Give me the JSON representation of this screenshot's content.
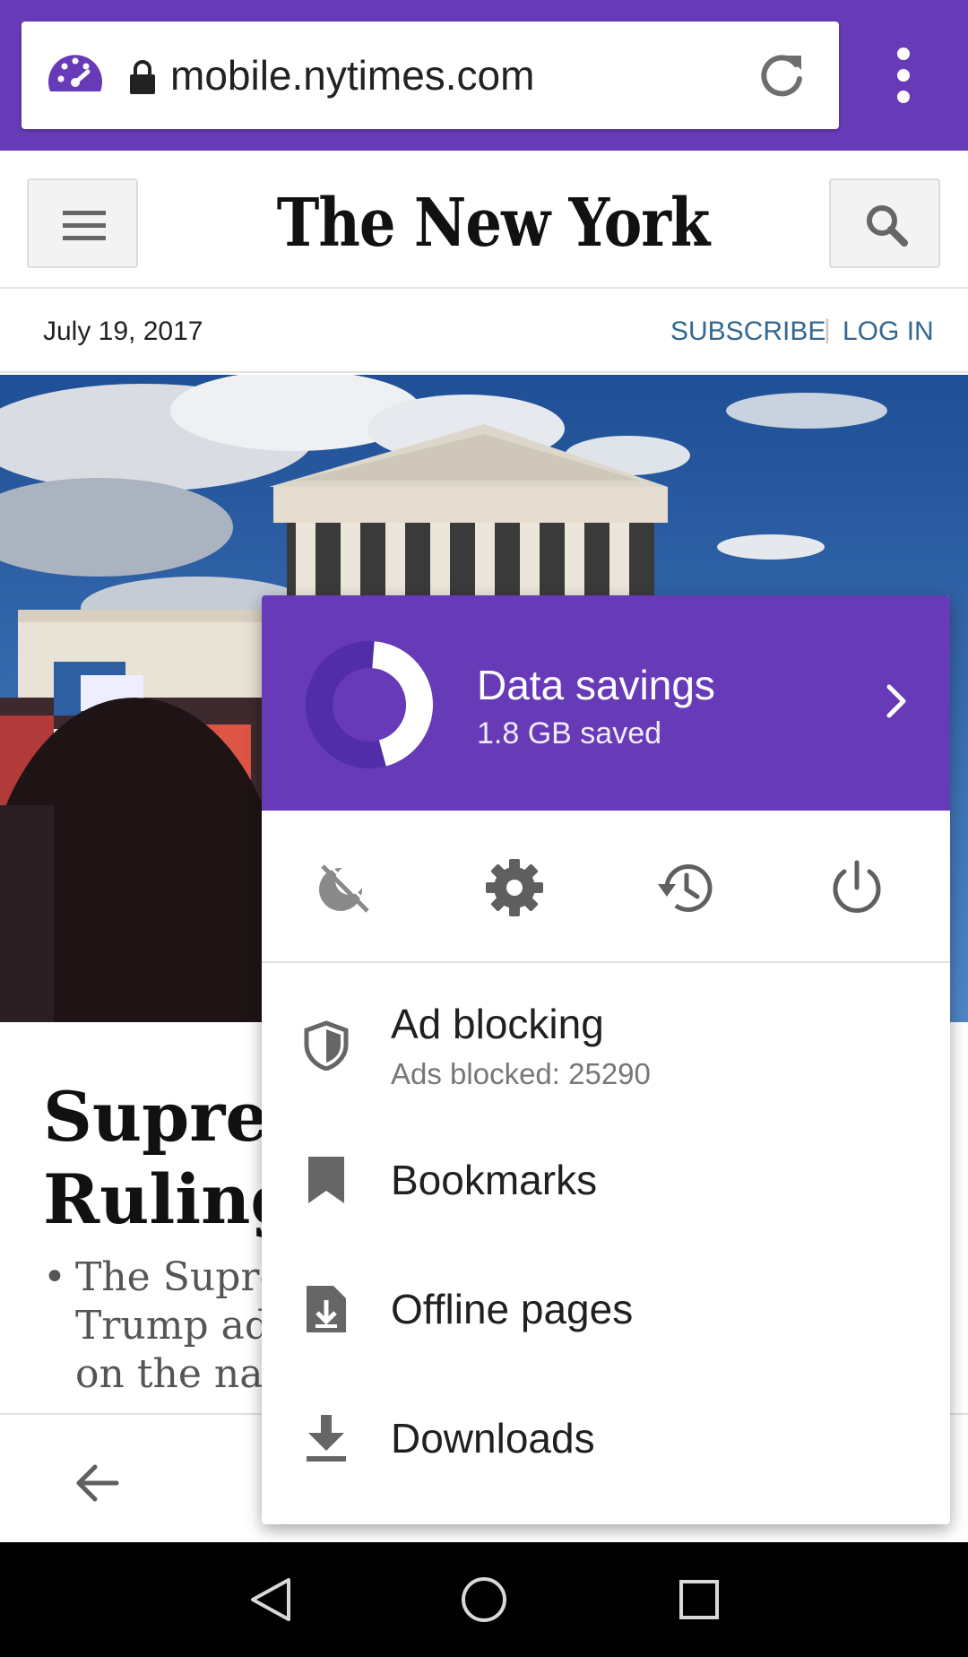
{
  "browser": {
    "url": "mobile.nytimes.com",
    "accent_color": "#673ab7",
    "icons": [
      "data-saver-gauge-icon",
      "lock-icon",
      "reload-icon",
      "overflow-menu-icon"
    ]
  },
  "site": {
    "masthead": "The New York Times",
    "date": "July 19, 2017",
    "subscribe": "SUBSCRIBE",
    "separator": "|",
    "login": "LOG IN",
    "link_color": "#326891"
  },
  "article": {
    "headline_line1": "Suprem",
    "headline_line2": "Ruling o",
    "bullet_line1": "The Supre",
    "bullet_line2": "Trump adi",
    "bullet_line3": "on the nat"
  },
  "menu": {
    "data_savings": {
      "title": "Data savings",
      "subtitle": "1.8 GB saved",
      "ring_fraction": 0.47
    },
    "icons_row": [
      "incognito-icon",
      "settings-icon",
      "history-icon",
      "power-icon"
    ],
    "items": [
      {
        "label": "Ad blocking",
        "sub": "Ads blocked: 25290",
        "icon": "shield-icon"
      },
      {
        "label": "Bookmarks",
        "icon": "bookmark-icon"
      },
      {
        "label": "Offline pages",
        "icon": "offline-page-icon"
      },
      {
        "label": "Downloads",
        "icon": "download-icon"
      }
    ]
  },
  "android_nav": [
    "back-triangle-icon",
    "home-circle-icon",
    "recents-square-icon"
  ]
}
